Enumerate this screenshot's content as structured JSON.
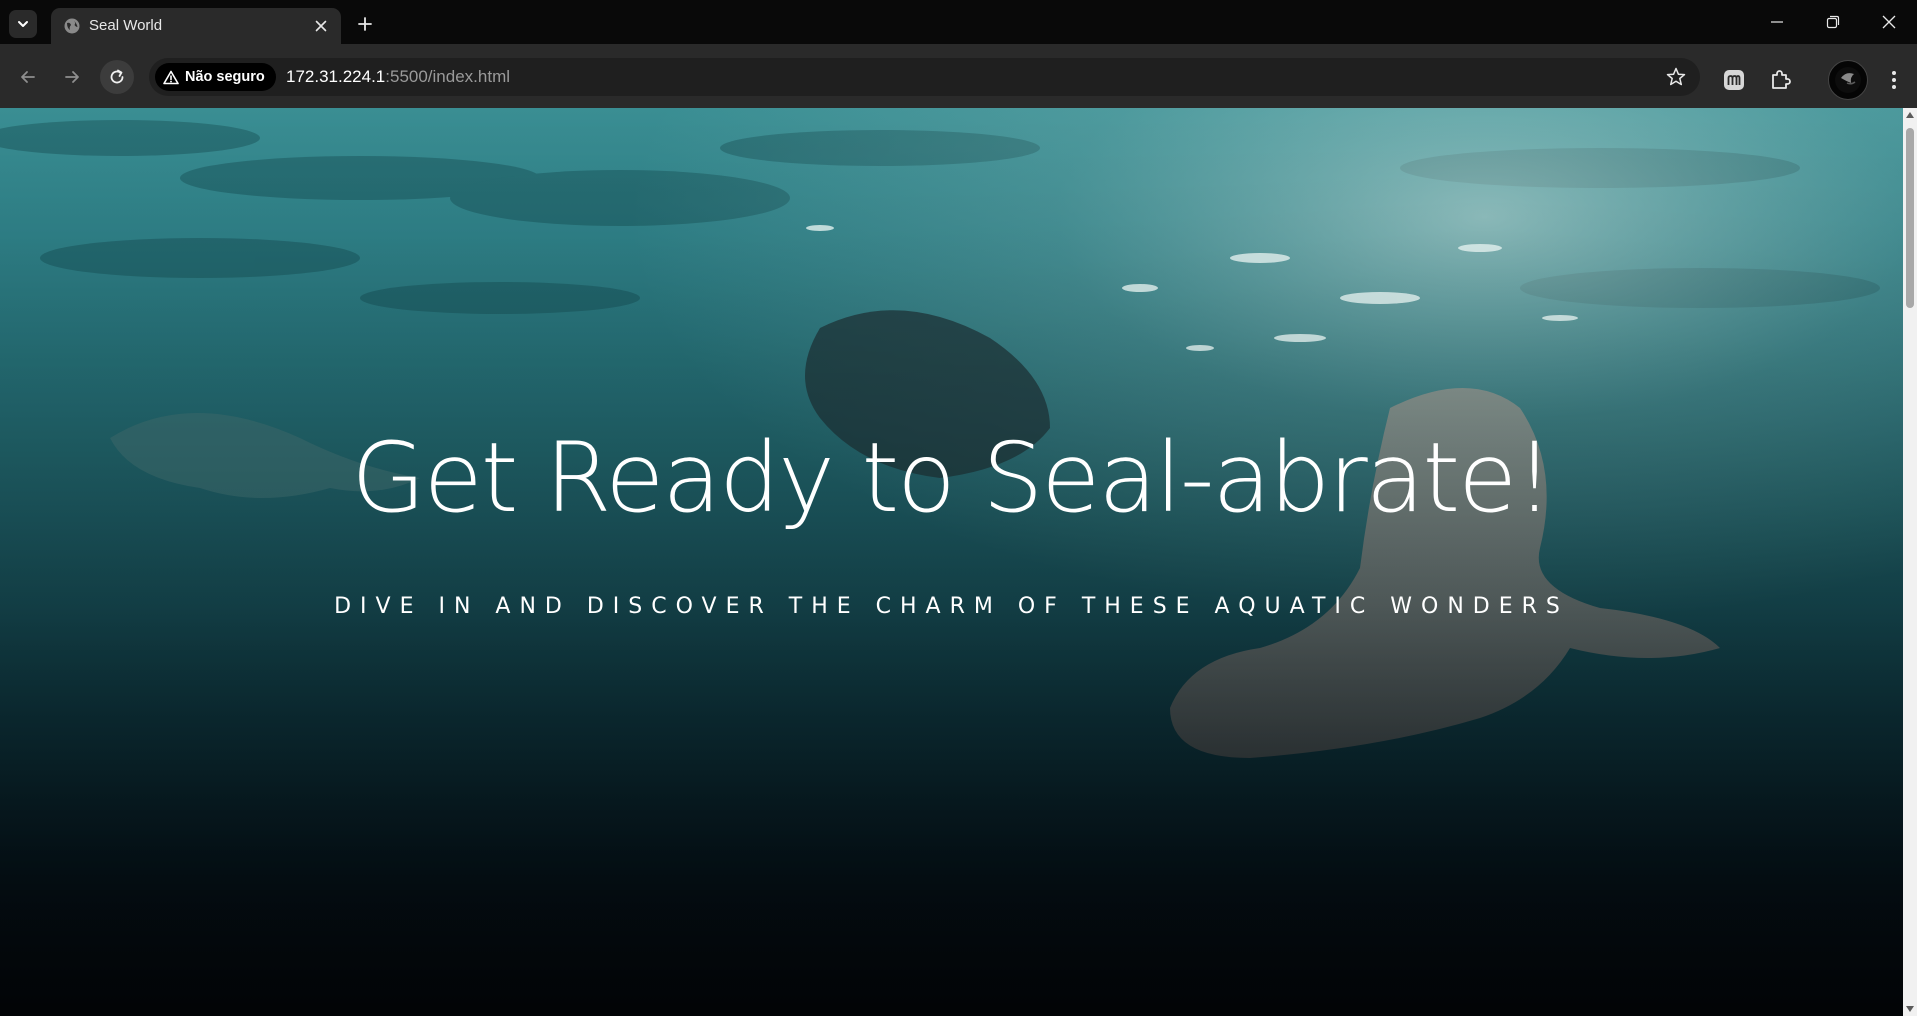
{
  "window": {
    "minimize_icon": "minimize-icon",
    "maximize_icon": "restore-icon",
    "close_icon": "close-icon"
  },
  "tab": {
    "title": "Seal World",
    "favicon": "globe-icon",
    "close_icon": "close-icon"
  },
  "toolbar": {
    "security_label": "Não seguro",
    "url_host": "172.31.224.1",
    "url_path": ":5500/index.html"
  },
  "hero": {
    "title": "Get Ready to Seal-abrate!",
    "subtitle": "DIVE IN AND DISCOVER THE CHARM OF THESE AQUATIC WONDERS"
  },
  "colors": {
    "tabstrip": "#090909",
    "toolbar": "#2a2a2a",
    "omnibox": "#1f1f1f",
    "water_top": "#3a8e93",
    "water_bottom": "#04080d",
    "text": "#ffffff"
  }
}
